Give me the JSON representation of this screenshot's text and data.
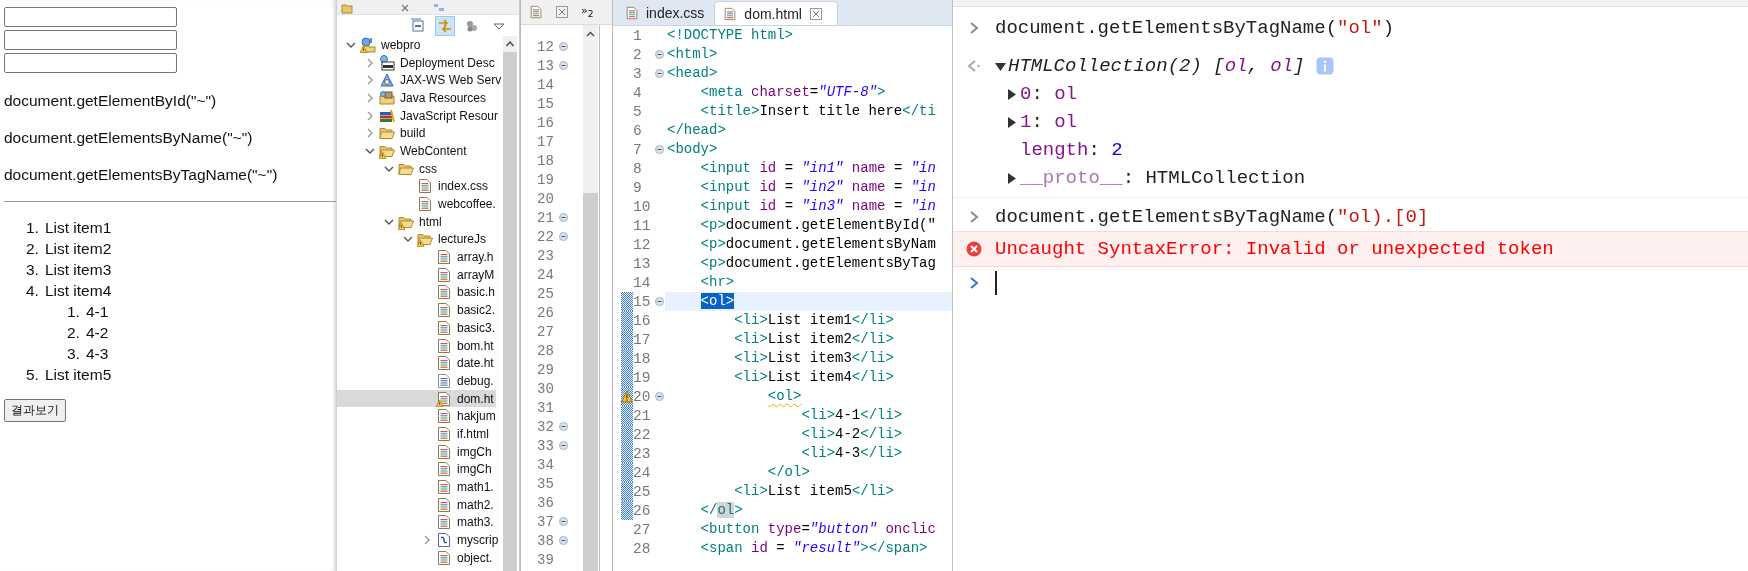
{
  "browser_page": {
    "fields": [
      {
        "kind": "text"
      },
      {
        "kind": "text"
      },
      {
        "kind": "text"
      }
    ],
    "paragraphs": [
      "document.getElementById(\"~\")",
      "document.getElementsByName(\"~\")",
      "document.getElementsByTagName(\"~\")"
    ],
    "list": [
      {
        "marker": "1.",
        "text": "List item1"
      },
      {
        "marker": "2.",
        "text": "List item2"
      },
      {
        "marker": "3.",
        "text": "List item3"
      },
      {
        "marker": "4.",
        "text": "List item4",
        "children": [
          {
            "marker": "1.",
            "text": "4-1"
          },
          {
            "marker": "2.",
            "text": "4-2"
          },
          {
            "marker": "3.",
            "text": "4-3"
          }
        ]
      },
      {
        "marker": "5.",
        "text": "List item5"
      }
    ],
    "button": "결과보기"
  },
  "project_explorer": {
    "toolbar": [
      {
        "kind": "collapse",
        "selected": false
      },
      {
        "kind": "link",
        "selected": true
      },
      {
        "kind": "filter",
        "selected": false
      },
      {
        "kind": "menu",
        "selected": false
      }
    ],
    "tree": [
      {
        "label": "webpro",
        "kind": "project",
        "warning": true,
        "selected": false,
        "expanded": true,
        "children": [
          {
            "label": "Deployment Desc",
            "kind": "descriptor",
            "warning": false,
            "selected": false,
            "expanded": false
          },
          {
            "label": "JAX-WS Web Serv",
            "kind": "service",
            "warning": false,
            "selected": false,
            "expanded": false
          },
          {
            "label": "Java Resources",
            "kind": "java-lib",
            "warning": false,
            "selected": false,
            "expanded": false
          },
          {
            "label": "JavaScript Resour",
            "kind": "js-lib",
            "warning": false,
            "selected": false,
            "expanded": false
          },
          {
            "label": "build",
            "kind": "folder",
            "warning": false,
            "selected": false,
            "expanded": false
          },
          {
            "label": "WebContent",
            "kind": "folder",
            "warning": true,
            "selected": false,
            "expanded": true,
            "children": [
              {
                "label": "css",
                "kind": "folder",
                "warning": false,
                "selected": false,
                "expanded": true,
                "children": [
                  {
                    "label": "index.css",
                    "kind": "html-file",
                    "warning": false,
                    "selected": false
                  },
                  {
                    "label": "webcoffee.",
                    "kind": "html-file",
                    "warning": false,
                    "selected": false
                  }
                ]
              },
              {
                "label": "html",
                "kind": "folder",
                "warning": true,
                "selected": false,
                "expanded": true,
                "children": [
                  {
                    "label": "lectureJs",
                    "kind": "folder",
                    "warning": true,
                    "selected": false,
                    "expanded": true,
                    "children": [
                      {
                        "label": "array.h",
                        "kind": "html-file",
                        "warning": false,
                        "selected": false
                      },
                      {
                        "label": "arrayM",
                        "kind": "html-file",
                        "warning": false,
                        "selected": false
                      },
                      {
                        "label": "basic.h",
                        "kind": "html-file",
                        "warning": false,
                        "selected": false
                      },
                      {
                        "label": "basic2.",
                        "kind": "html-file",
                        "warning": false,
                        "selected": false
                      },
                      {
                        "label": "basic3.",
                        "kind": "html-file",
                        "warning": false,
                        "selected": false
                      },
                      {
                        "label": "bom.ht",
                        "kind": "html-file",
                        "warning": false,
                        "selected": false
                      },
                      {
                        "label": "date.ht",
                        "kind": "html-file",
                        "warning": false,
                        "selected": false
                      },
                      {
                        "label": "debug.",
                        "kind": "text-file",
                        "warning": false,
                        "selected": false
                      },
                      {
                        "label": "dom.ht",
                        "kind": "html-file",
                        "warning": true,
                        "selected": true
                      },
                      {
                        "label": "hakjum",
                        "kind": "html-file",
                        "warning": false,
                        "selected": false
                      },
                      {
                        "label": "if.html",
                        "kind": "html-file",
                        "warning": false,
                        "selected": false
                      },
                      {
                        "label": "imgCh",
                        "kind": "html-file",
                        "warning": false,
                        "selected": false
                      },
                      {
                        "label": "imgCh",
                        "kind": "html-file",
                        "warning": false,
                        "selected": false
                      },
                      {
                        "label": "math1.",
                        "kind": "html-file",
                        "warning": false,
                        "selected": false
                      },
                      {
                        "label": "math2.",
                        "kind": "html-file",
                        "warning": false,
                        "selected": false
                      },
                      {
                        "label": "math3.",
                        "kind": "html-file",
                        "warning": false,
                        "selected": false
                      },
                      {
                        "label": "myscrip",
                        "kind": "script-file",
                        "warning": false,
                        "selected": false,
                        "expanded": false
                      },
                      {
                        "label": "object.",
                        "kind": "html-file",
                        "warning": false,
                        "selected": false
                      }
                    ]
                  }
                ]
              }
            ]
          }
        ]
      }
    ]
  },
  "second_editor": {
    "overflow_tabs": "»$_{2}$",
    "lines": [
      {
        "number": "12",
        "fold": true
      },
      {
        "number": "13",
        "fold": true
      },
      {
        "number": "14",
        "fold": false
      },
      {
        "number": "15",
        "fold": false
      },
      {
        "number": "16",
        "fold": false
      },
      {
        "number": "17",
        "fold": false
      },
      {
        "number": "18",
        "fold": false
      },
      {
        "number": "19",
        "fold": false
      },
      {
        "number": "20",
        "fold": false
      },
      {
        "number": "21",
        "fold": true
      },
      {
        "number": "22",
        "fold": true
      },
      {
        "number": "23",
        "fold": false
      },
      {
        "number": "24",
        "fold": false
      },
      {
        "number": "25",
        "fold": false
      },
      {
        "number": "26",
        "fold": false
      },
      {
        "number": "27",
        "fold": false
      },
      {
        "number": "28",
        "fold": false
      },
      {
        "number": "29",
        "fold": false
      },
      {
        "number": "30",
        "fold": false
      },
      {
        "number": "31",
        "fold": false
      },
      {
        "number": "32",
        "fold": true
      },
      {
        "number": "33",
        "fold": true
      },
      {
        "number": "34",
        "fold": false
      },
      {
        "number": "35",
        "fold": false
      },
      {
        "number": "36",
        "fold": false
      },
      {
        "number": "37",
        "fold": true
      },
      {
        "number": "38",
        "fold": true
      },
      {
        "number": "39",
        "fold": false
      }
    ]
  },
  "editor": {
    "tabs": [
      {
        "label": "index.css",
        "selected": false
      },
      {
        "label": "dom.html",
        "selected": true
      }
    ],
    "lines": [
      {
        "number": "1",
        "fold": false,
        "range": false,
        "current": false,
        "warning": false,
        "tokens": [
          {
            "kind": "tag",
            "text": "<!DOCTYPE html>"
          }
        ]
      },
      {
        "number": "2",
        "fold": true,
        "range": false,
        "current": false,
        "warning": false,
        "tokens": [
          {
            "kind": "tag",
            "text": "<html>"
          }
        ]
      },
      {
        "number": "3",
        "fold": true,
        "range": false,
        "current": false,
        "warning": false,
        "tokens": [
          {
            "kind": "tag",
            "text": "<head>"
          }
        ],
        "children": [
          {
            "number": "4",
            "fold": false,
            "range": false,
            "current": false,
            "warning": false,
            "tokens": [
              {
                "kind": "tag",
                "text": "<meta"
              },
              {
                "kind": "attr",
                "text": " charset"
              },
              {
                "kind": "text",
                "text": "="
              },
              {
                "kind": "value",
                "text": "\"UTF-8\""
              },
              {
                "kind": "tag",
                "text": ">"
              }
            ]
          },
          {
            "number": "5",
            "fold": false,
            "range": false,
            "current": false,
            "warning": false,
            "tokens": [
              {
                "kind": "tag",
                "text": "<title>"
              },
              {
                "kind": "text",
                "text": "Insert title here"
              },
              {
                "kind": "tag",
                "text": "</ti"
              }
            ]
          }
        ]
      },
      {
        "number": "6",
        "fold": false,
        "range": false,
        "current": false,
        "warning": false,
        "tokens": [
          {
            "kind": "tag",
            "text": "</head>"
          }
        ]
      },
      {
        "number": "7",
        "fold": true,
        "range": false,
        "current": false,
        "warning": false,
        "tokens": [
          {
            "kind": "tag",
            "text": "<body>"
          }
        ],
        "children": [
          {
            "number": "8",
            "fold": false,
            "range": false,
            "current": false,
            "warning": false,
            "tokens": [
              {
                "kind": "tag",
                "text": "<input"
              },
              {
                "kind": "attr",
                "text": " id"
              },
              {
                "kind": "text",
                "text": " = "
              },
              {
                "kind": "value",
                "text": "\"in1\""
              },
              {
                "kind": "attr",
                "text": " name"
              },
              {
                "kind": "text",
                "text": " = "
              },
              {
                "kind": "value",
                "text": "\"in"
              }
            ]
          },
          {
            "number": "9",
            "fold": false,
            "range": false,
            "current": false,
            "warning": false,
            "tokens": [
              {
                "kind": "tag",
                "text": "<input"
              },
              {
                "kind": "attr",
                "text": " id"
              },
              {
                "kind": "text",
                "text": " = "
              },
              {
                "kind": "value",
                "text": "\"in2\""
              },
              {
                "kind": "attr",
                "text": " name"
              },
              {
                "kind": "text",
                "text": " = "
              },
              {
                "kind": "value",
                "text": "\"in"
              }
            ]
          },
          {
            "number": "10",
            "fold": false,
            "range": false,
            "current": false,
            "warning": false,
            "tokens": [
              {
                "kind": "tag",
                "text": "<input"
              },
              {
                "kind": "attr",
                "text": " id"
              },
              {
                "kind": "text",
                "text": " = "
              },
              {
                "kind": "value",
                "text": "\"in3\""
              },
              {
                "kind": "attr",
                "text": " name"
              },
              {
                "kind": "text",
                "text": " = "
              },
              {
                "kind": "value",
                "text": "\"in"
              }
            ]
          },
          {
            "number": "11",
            "fold": false,
            "range": false,
            "current": false,
            "warning": false,
            "tokens": [
              {
                "kind": "tag",
                "text": "<p>"
              },
              {
                "kind": "text",
                "text": "document.getElementById(\""
              }
            ]
          },
          {
            "number": "12",
            "fold": false,
            "range": false,
            "current": false,
            "warning": false,
            "tokens": [
              {
                "kind": "tag",
                "text": "<p>"
              },
              {
                "kind": "text",
                "text": "document.getElementsByNam"
              }
            ]
          },
          {
            "number": "13",
            "fold": false,
            "range": false,
            "current": false,
            "warning": false,
            "tokens": [
              {
                "kind": "tag",
                "text": "<p>"
              },
              {
                "kind": "text",
                "text": "document.getElementsByTag"
              }
            ]
          },
          {
            "number": "14",
            "fold": false,
            "range": false,
            "current": false,
            "warning": false,
            "tokens": [
              {
                "kind": "tag",
                "text": "<hr>"
              }
            ]
          },
          {
            "number": "15",
            "fold": true,
            "range": true,
            "current": true,
            "warning": false,
            "tokens": [
              {
                "kind": "selected",
                "text": "<ol>"
              }
            ],
            "children": [
              {
                "number": "16",
                "fold": false,
                "range": true,
                "current": false,
                "warning": false,
                "tokens": [
                  {
                    "kind": "tag",
                    "text": "<li>"
                  },
                  {
                    "kind": "text",
                    "text": "List item1"
                  },
                  {
                    "kind": "tag",
                    "text": "</li>"
                  }
                ]
              },
              {
                "number": "17",
                "fold": false,
                "range": true,
                "current": false,
                "warning": false,
                "tokens": [
                  {
                    "kind": "tag",
                    "text": "<li>"
                  },
                  {
                    "kind": "text",
                    "text": "List item2"
                  },
                  {
                    "kind": "tag",
                    "text": "</li>"
                  }
                ]
              },
              {
                "number": "18",
                "fold": false,
                "range": true,
                "current": false,
                "warning": false,
                "tokens": [
                  {
                    "kind": "tag",
                    "text": "<li>"
                  },
                  {
                    "kind": "text",
                    "text": "List item3"
                  },
                  {
                    "kind": "tag",
                    "text": "</li>"
                  }
                ]
              },
              {
                "number": "19",
                "fold": false,
                "range": true,
                "current": false,
                "warning": false,
                "tokens": [
                  {
                    "kind": "tag",
                    "text": "<li>"
                  },
                  {
                    "kind": "text",
                    "text": "List item4"
                  },
                  {
                    "kind": "tag",
                    "text": "</li>"
                  }
                ],
                "children": [
                  {
                    "number": "20",
                    "fold": true,
                    "range": true,
                    "current": false,
                    "warning": true,
                    "tokens": [
                      {
                        "kind": "flagged",
                        "text": "<ol>"
                      }
                    ],
                    "children": [
                      {
                        "number": "21",
                        "fold": false,
                        "range": true,
                        "current": false,
                        "warning": false,
                        "tokens": [
                          {
                            "kind": "tag",
                            "text": "<li>"
                          },
                          {
                            "kind": "text",
                            "text": "4-1"
                          },
                          {
                            "kind": "tag",
                            "text": "</li>"
                          }
                        ]
                      },
                      {
                        "number": "22",
                        "fold": false,
                        "range": true,
                        "current": false,
                        "warning": false,
                        "tokens": [
                          {
                            "kind": "tag",
                            "text": "<li>"
                          },
                          {
                            "kind": "text",
                            "text": "4-2"
                          },
                          {
                            "kind": "tag",
                            "text": "</li>"
                          }
                        ]
                      },
                      {
                        "number": "23",
                        "fold": false,
                        "range": true,
                        "current": false,
                        "warning": false,
                        "tokens": [
                          {
                            "kind": "tag",
                            "text": "<li>"
                          },
                          {
                            "kind": "text",
                            "text": "4-3"
                          },
                          {
                            "kind": "tag",
                            "text": "</li>"
                          }
                        ]
                      }
                    ]
                  },
                  {
                    "number": "24",
                    "fold": false,
                    "range": true,
                    "current": false,
                    "warning": false,
                    "tokens": [
                      {
                        "kind": "tag",
                        "text": "</ol>"
                      }
                    ]
                  }
                ]
              },
              {
                "number": "25",
                "fold": false,
                "range": true,
                "current": false,
                "warning": false,
                "tokens": [
                  {
                    "kind": "tag",
                    "text": "<li>"
                  },
                  {
                    "kind": "text",
                    "text": "List item5"
                  },
                  {
                    "kind": "tag",
                    "text": "</li>"
                  }
                ]
              }
            ]
          },
          {
            "number": "26",
            "fold": false,
            "range": true,
            "current": false,
            "warning": false,
            "tokens": [
              {
                "kind": "tag",
                "text": "</"
              },
              {
                "kind": "match",
                "text": "ol"
              },
              {
                "kind": "tag",
                "text": ">"
              }
            ]
          },
          {
            "number": "27",
            "fold": false,
            "range": false,
            "current": false,
            "warning": false,
            "tokens": [
              {
                "kind": "tag",
                "text": "<button"
              },
              {
                "kind": "attr",
                "text": " type"
              },
              {
                "kind": "text",
                "text": "="
              },
              {
                "kind": "value",
                "text": "\"button\""
              },
              {
                "kind": "attr",
                "text": " onclic"
              }
            ]
          },
          {
            "number": "28",
            "fold": false,
            "range": false,
            "current": false,
            "warning": false,
            "tokens": [
              {
                "kind": "tag",
                "text": "<span"
              },
              {
                "kind": "attr",
                "text": " id"
              },
              {
                "kind": "text",
                "text": " = "
              },
              {
                "kind": "value",
                "text": "\"result\""
              },
              {
                "kind": "tag",
                "text": "></span>"
              }
            ]
          }
        ]
      }
    ]
  },
  "console": {
    "entries": [
      {
        "kind": "input",
        "parts": [
          {
            "kind": "code",
            "text": "document.getElementsByTagName("
          },
          {
            "kind": "string",
            "text": "\"ol\""
          },
          {
            "kind": "code",
            "text": ")"
          }
        ]
      },
      {
        "kind": "result",
        "expanded": true,
        "parts": [
          {
            "kind": "code",
            "text": "HTMLCollection(2) ["
          },
          {
            "kind": "key",
            "text": "ol"
          },
          {
            "kind": "code",
            "text": ", "
          },
          {
            "kind": "key",
            "text": "ol"
          },
          {
            "kind": "code",
            "text": "]"
          }
        ],
        "children": [
          {
            "kind": "object",
            "expanded": false,
            "parts": [
              {
                "kind": "key",
                "text": "0"
              },
              {
                "kind": "code",
                "text": ": "
              },
              {
                "kind": "key",
                "text": "ol"
              }
            ]
          },
          {
            "kind": "object",
            "expanded": false,
            "parts": [
              {
                "kind": "key",
                "text": "1"
              },
              {
                "kind": "code",
                "text": ": "
              },
              {
                "kind": "key",
                "text": "ol"
              }
            ]
          },
          {
            "kind": "property",
            "parts": [
              {
                "kind": "key",
                "text": "length"
              },
              {
                "kind": "code",
                "text": ": "
              },
              {
                "kind": "number",
                "text": "2"
              }
            ]
          },
          {
            "kind": "object",
            "expanded": false,
            "parts": [
              {
                "kind": "dim-key",
                "text": "__proto__"
              },
              {
                "kind": "code",
                "text": ": HTMLCollection"
              }
            ]
          }
        ]
      },
      {
        "kind": "input",
        "parts": [
          {
            "kind": "code",
            "text": "document.getElementsByTagName("
          },
          {
            "kind": "string",
            "text": "\"ol).[0]"
          }
        ]
      },
      {
        "kind": "error",
        "parts": [
          {
            "kind": "error",
            "text": "Uncaught SyntaxError: Invalid or unexpected token"
          }
        ]
      },
      {
        "kind": "prompt"
      }
    ]
  }
}
